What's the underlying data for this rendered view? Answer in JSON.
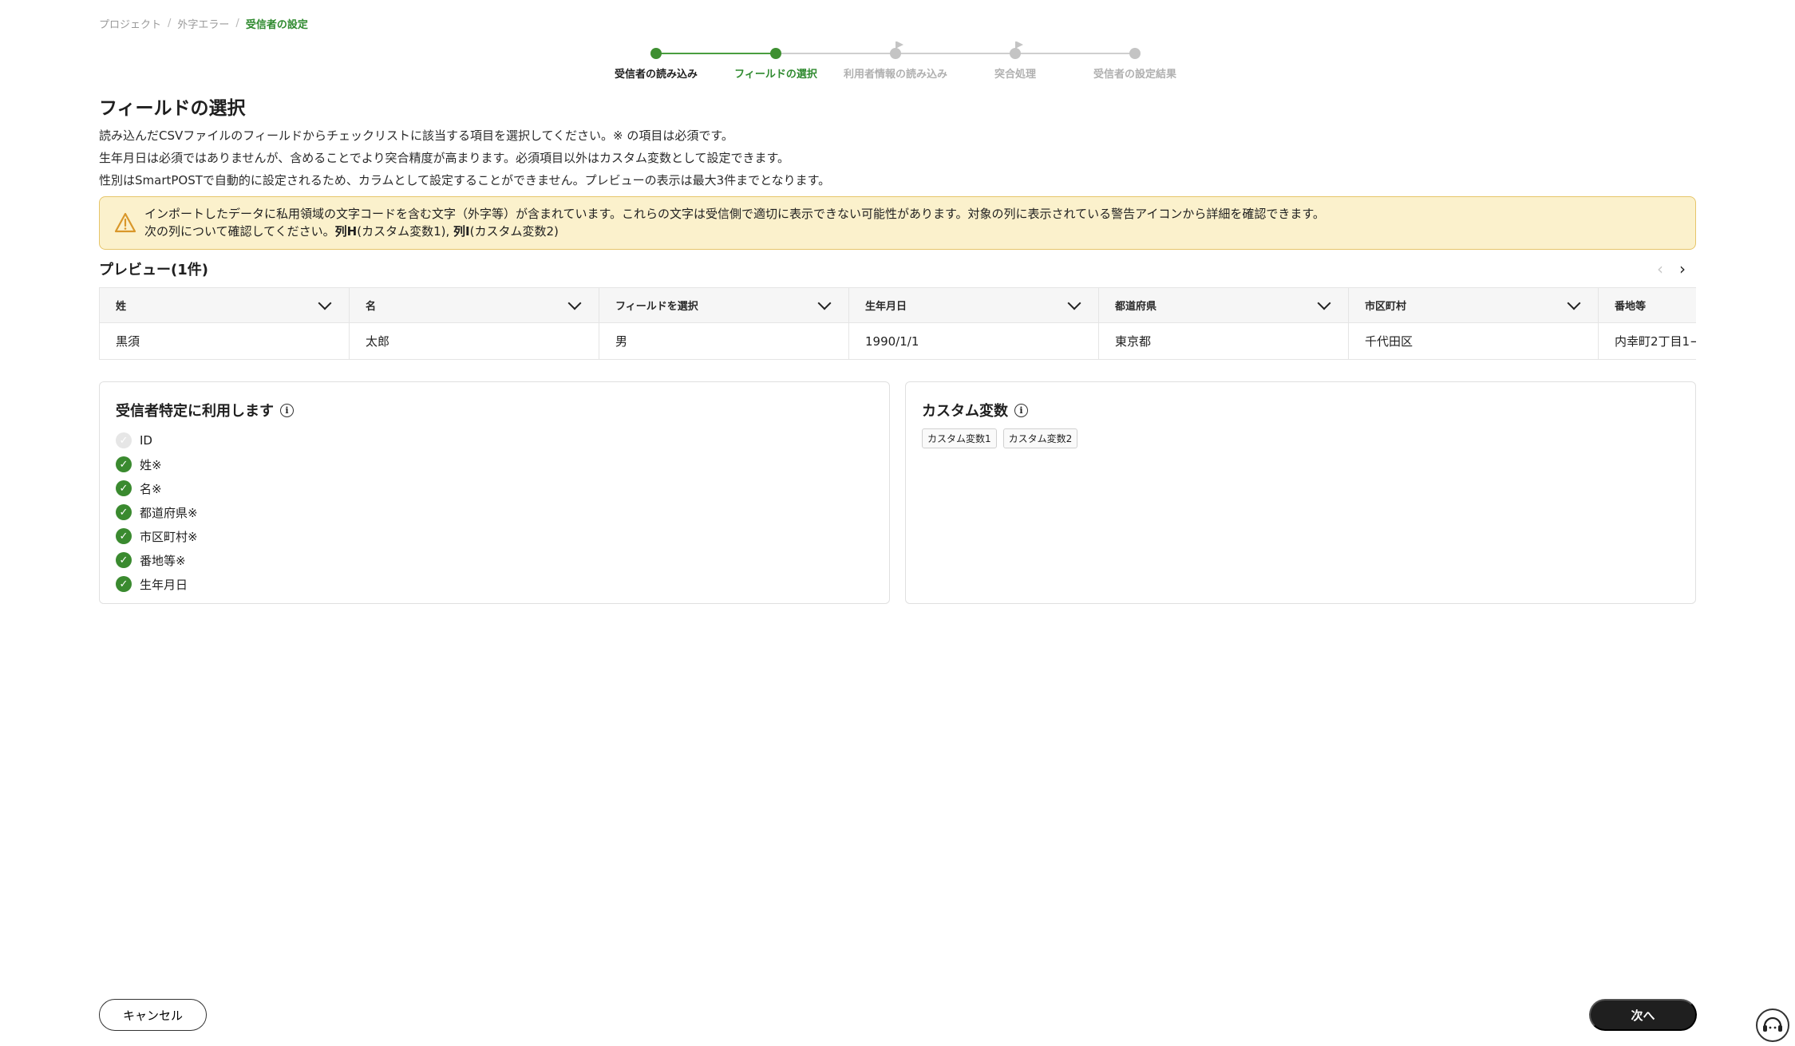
{
  "breadcrumb": {
    "items": [
      "プロジェクト",
      "外字エラー"
    ],
    "separator": "/",
    "current": "受信者の設定"
  },
  "stepper": {
    "steps": [
      {
        "label": "受信者の読み込み",
        "state": "done"
      },
      {
        "label": "フィールドの選択",
        "state": "current"
      },
      {
        "label": "利用者情報の読み込み",
        "state": "pending"
      },
      {
        "label": "突合処理",
        "state": "pending"
      },
      {
        "label": "受信者の設定結果",
        "state": "pending"
      }
    ]
  },
  "page": {
    "title": "フィールドの選択",
    "description": [
      "読み込んだCSVファイルのフィールドからチェックリストに該当する項目を選択してください。※ の項目は必須です。",
      "生年月日は必須ではありませんが、含めることでより突合精度が高まります。必須項目以外はカスタム変数として設定できます。",
      "性別はSmartPOSTで自動的に設定されるため、カラムとして設定することができません。プレビューの表示は最大3件までとなります。"
    ]
  },
  "alert": {
    "line1": "インポートしたデータに私用領域の文字コードを含む文字（外字等）が含まれています。これらの文字は受信側で適切に表示できない可能性があります。対象の列に表示されている警告アイコンから詳細を確認できます。",
    "line2_prefix": "次の列について確認してください。",
    "col_h": "列H",
    "col_h_suffix": "(カスタム変数1), ",
    "col_i": "列I",
    "col_i_suffix": "(カスタム変数2)",
    "icon": "warning-icon",
    "color": "#fbf1cc"
  },
  "preview": {
    "title": "プレビュー(1件)",
    "prev": "‹",
    "next": "›",
    "headers": [
      "姓",
      "名",
      "フィールドを選択",
      "生年月日",
      "都道府県",
      "市区町村",
      "番地等"
    ],
    "rows": [
      [
        "黒須",
        "太郎",
        "男",
        "1990/1/1",
        "東京都",
        "千代田区",
        "内幸町2丁目1−"
      ]
    ]
  },
  "identify_panel": {
    "title": "受信者特定に利用します",
    "items": [
      {
        "label": "ID",
        "checked": false
      },
      {
        "label": "姓※",
        "checked": true
      },
      {
        "label": "名※",
        "checked": true
      },
      {
        "label": "都道府県※",
        "checked": true
      },
      {
        "label": "市区町村※",
        "checked": true
      },
      {
        "label": "番地等※",
        "checked": true
      },
      {
        "label": "生年月日",
        "checked": true
      }
    ]
  },
  "custom_panel": {
    "title": "カスタム変数",
    "tags": [
      "カスタム変数1",
      "カスタム変数2"
    ]
  },
  "footer": {
    "cancel": "キャンセル",
    "next": "次へ"
  },
  "colors": {
    "accent": "#3e8f31",
    "primary_button": "#1f1f1f"
  }
}
